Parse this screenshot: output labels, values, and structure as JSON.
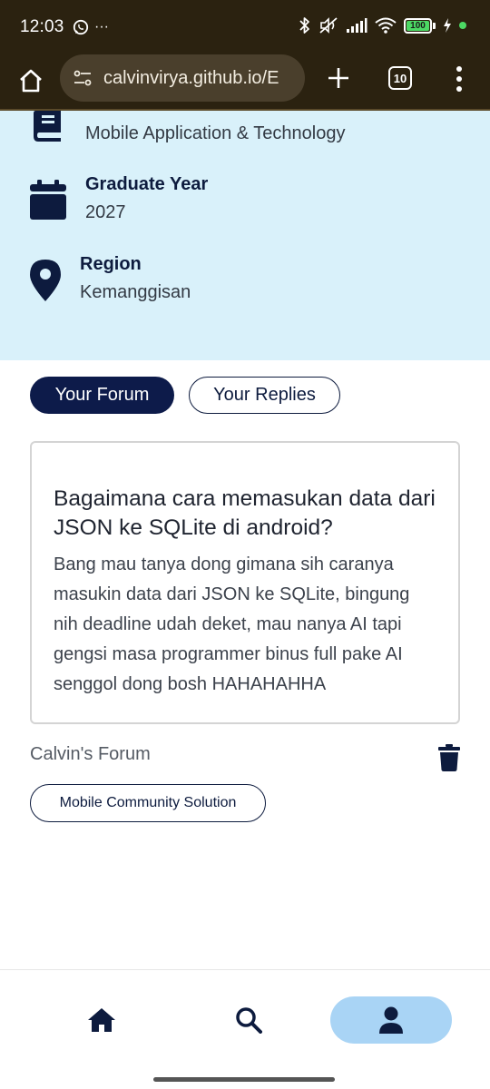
{
  "status_bar": {
    "time": "12:03",
    "more": "···",
    "battery": "100",
    "icons": [
      "whatsapp-icon",
      "bluetooth-icon",
      "mute-icon",
      "signal-icon",
      "wifi-icon",
      "battery-icon",
      "charging-icon"
    ]
  },
  "browser": {
    "url": "calvinvirya.github.io/E",
    "tab_count": "10",
    "icons": [
      "home-icon",
      "site-settings-icon",
      "plus-icon",
      "tabs-icon",
      "more-vert-icon"
    ]
  },
  "profile_info": {
    "major_value": "Mobile Application & Technology",
    "graduate_year_label": "Graduate Year",
    "graduate_year_value": "2027",
    "region_label": "Region",
    "region_value": "Kemanggisan"
  },
  "tabs": {
    "your_forum": "Your Forum",
    "your_replies": "Your Replies",
    "active": "your_forum"
  },
  "forum": {
    "title": "Bagaimana cara memasukan data dari JSON ke SQLite di android?",
    "body": "Bang mau tanya dong gimana sih caranya masukin data dari JSON ke SQLite, bingung nih deadline udah deket, mau nanya AI tapi gengsi masa programmer binus full pake AI senggol dong bosh HAHAHAHHA",
    "author": "Calvin's Forum",
    "category": "Mobile Community Solution"
  },
  "bottom_nav": {
    "items": [
      "home",
      "search",
      "profile"
    ],
    "active": "profile"
  },
  "colors": {
    "primary_navy": "#0d1b4a",
    "info_band_bg": "#d9f1fa",
    "active_nav_bg": "#a9d4f5",
    "browser_bg": "#2b2210"
  }
}
